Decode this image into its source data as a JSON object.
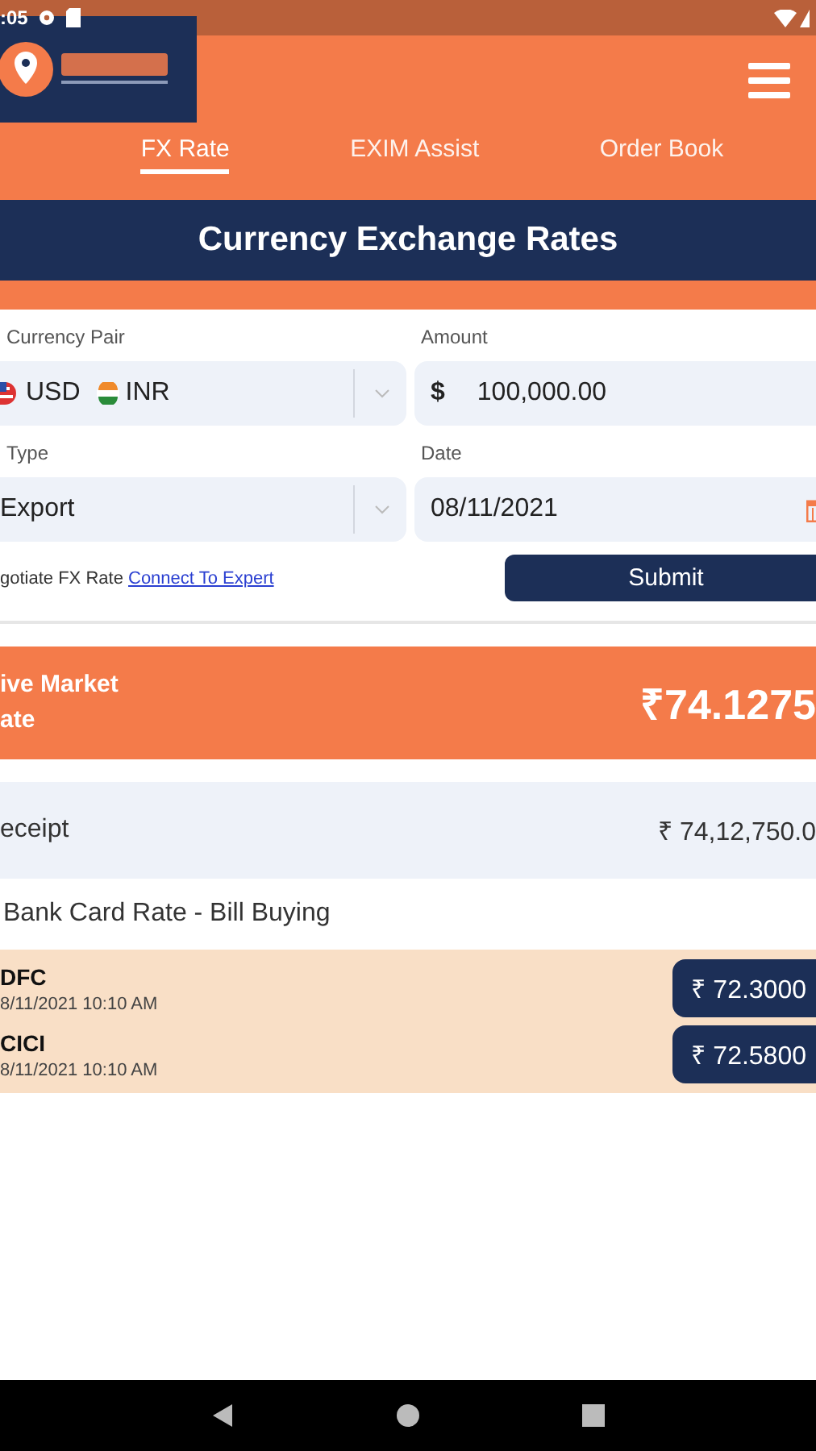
{
  "status_bar": {
    "time": ":05"
  },
  "header": {
    "tabs": [
      {
        "label": "FX Rate",
        "selected": true
      },
      {
        "label": "EXIM Assist",
        "selected": false
      },
      {
        "label": "Order Book",
        "selected": false
      }
    ]
  },
  "title": "Currency Exchange Rates",
  "form": {
    "currency_pair": {
      "label": "Currency Pair",
      "from": "USD",
      "to": "INR"
    },
    "amount": {
      "label": "Amount",
      "symbol": "$",
      "value": "100,000.00"
    },
    "type": {
      "label": "Type",
      "value": "Export"
    },
    "date": {
      "label": "Date",
      "value": "08/11/2021"
    },
    "negotiate": {
      "text": "gotiate FX Rate",
      "link": "Connect To Expert"
    },
    "submit": "Submit"
  },
  "live_rate": {
    "label_lines": [
      "ive Market",
      "ate"
    ],
    "value": "₹74.1275"
  },
  "receipt": {
    "label": "eceipt",
    "value": "₹ 74,12,750.0"
  },
  "bank_section": {
    "heading": "Bank Card Rate - Bill Buying",
    "banks": [
      {
        "name": "DFC",
        "time": "8/11/2021 10:10 AM",
        "rate": "₹ 72.3000"
      },
      {
        "name": "CICI",
        "time": "8/11/2021 10:10 AM",
        "rate": "₹ 72.5800"
      }
    ]
  }
}
